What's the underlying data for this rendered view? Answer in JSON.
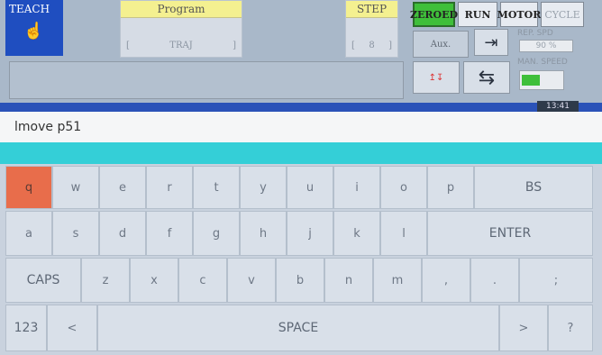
{
  "header": {
    "mode_label": "TEACH",
    "program_label": "Program",
    "program_value": "TRAJ",
    "step_label": "STEP",
    "step_value": "8",
    "zeroed_label": "ZEROED",
    "run_label": "RUN",
    "motor_label": "MOTOR",
    "cycle_label": "CYCLE",
    "aux_label": "Aux.",
    "rep_spd_label": "REP. SPD",
    "rep_spd_value": "90 %",
    "man_speed_label": "MAN. SPEED",
    "clock": "13:41"
  },
  "input": {
    "value": "lmove p51"
  },
  "keyboard": {
    "row1": [
      "q",
      "w",
      "e",
      "r",
      "t",
      "y",
      "u",
      "i",
      "o",
      "p",
      "BS"
    ],
    "row2": [
      "a",
      "s",
      "d",
      "f",
      "g",
      "h",
      "j",
      "k",
      "l",
      "ENTER"
    ],
    "row3": [
      "CAPS",
      "z",
      "x",
      "c",
      "v",
      "b",
      "n",
      "m",
      ",",
      ".",
      ";"
    ],
    "row4": [
      "123",
      "<",
      "SPACE",
      ">",
      "?"
    ]
  },
  "colors": {
    "active_key": "#e86d4b",
    "cyan_bar": "#34cfd7",
    "zeroed": "#3fbf3a"
  }
}
